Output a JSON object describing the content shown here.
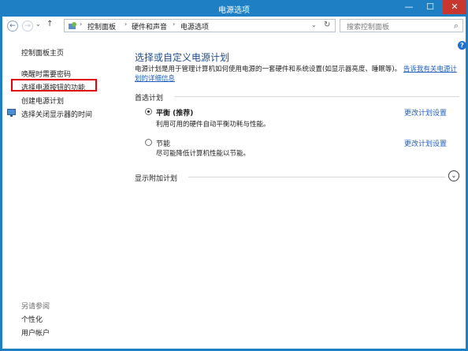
{
  "window": {
    "title": "电源选项",
    "minimize": "—",
    "maximize": "☐",
    "close": "✕"
  },
  "nav": {
    "back": "←",
    "forward": "→",
    "up": "↑",
    "breadcrumb": [
      "控制面板",
      "硬件和声音",
      "电源选项"
    ],
    "separator": "›",
    "refresh": "↻",
    "dropdown": "⌄",
    "search_placeholder": "搜索控制面板",
    "search_icon": "⌕"
  },
  "sidebar": {
    "home": "控制面板主页",
    "links": [
      "唤醒时需要密码",
      "选择电源按钮的功能",
      "创建电源计划",
      "选择关闭显示器的时间"
    ],
    "see_also_label": "另请参阅",
    "see_also": [
      "个性化",
      "用户帐户"
    ]
  },
  "main": {
    "help": "?",
    "heading": "选择或自定义电源计划",
    "description": "电源计划是用于管理计算机如何使用电源的一套硬件和系统设置(如显示器亮度、睡眠等)。",
    "description_link": "告诉我有关电源计划的详细信息",
    "preferred_label": "首选计划",
    "plans": [
      {
        "name": "平衡 (推荐)",
        "desc": "利用可用的硬件自动平衡功耗与性能。",
        "selected": true,
        "link": "更改计划设置"
      },
      {
        "name": "节能",
        "desc": "尽可能降低计算机性能以节能。",
        "selected": false,
        "link": "更改计划设置"
      }
    ],
    "show_additional": "显示附加计划",
    "expand_icon": "⌄"
  },
  "colors": {
    "accent": "#1f7fc4",
    "link": "#1f5fbf",
    "heading": "#1e4f8c",
    "highlight": "#e3000f"
  }
}
